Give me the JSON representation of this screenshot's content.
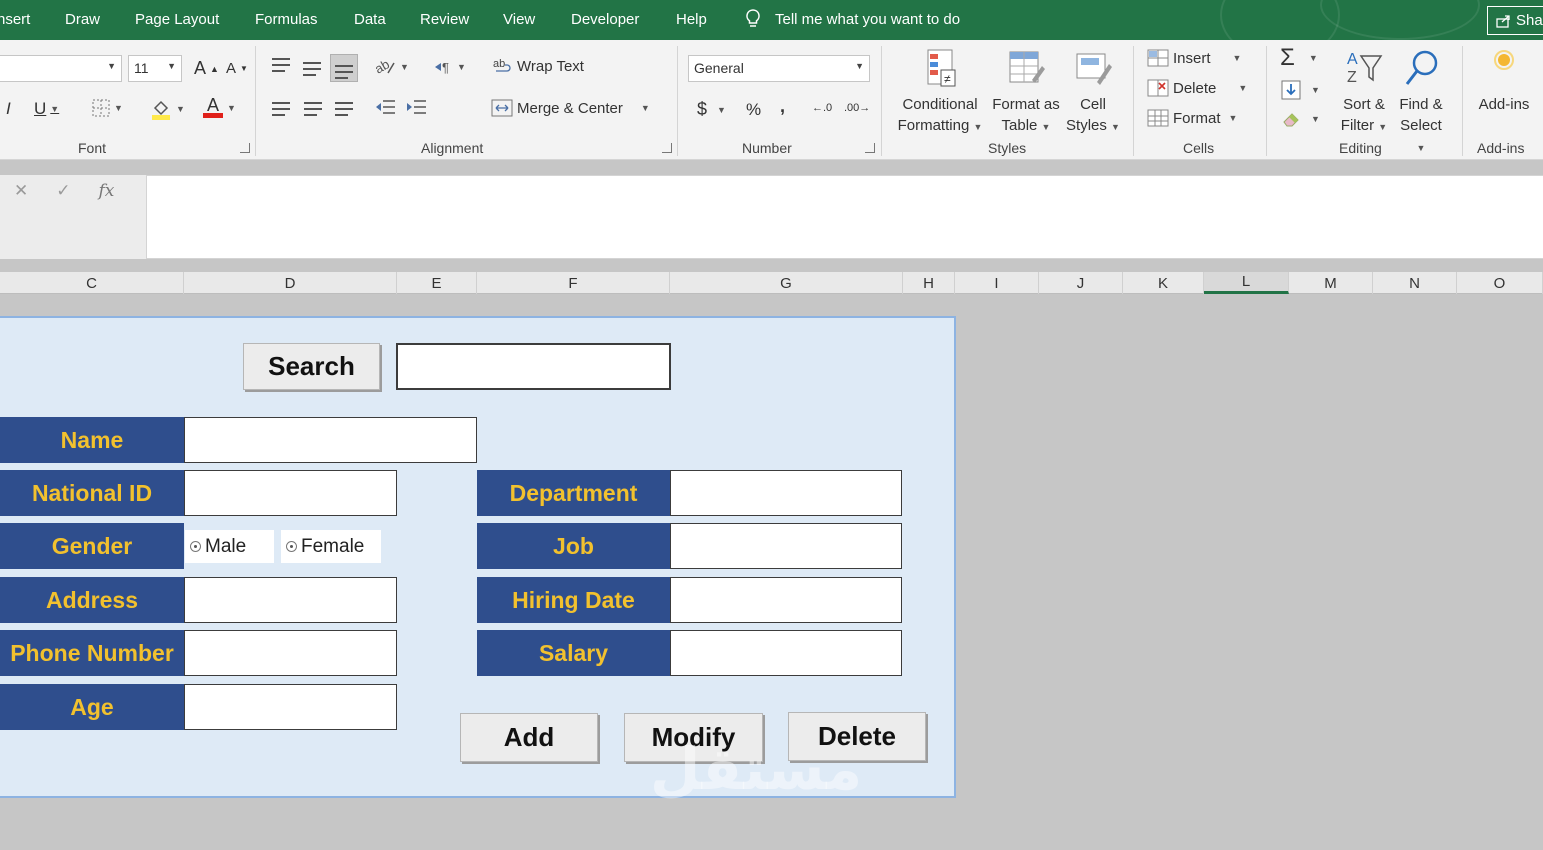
{
  "tabs": [
    "nsert",
    "Draw",
    "Page Layout",
    "Formulas",
    "Data",
    "Review",
    "View",
    "Developer",
    "Help"
  ],
  "tell_me": "Tell me what you want to do",
  "share_label": "Sha",
  "ribbon": {
    "font": {
      "font_name": "",
      "font_size": "11",
      "grow_font": "A",
      "shrink_font": "A",
      "italic": "I",
      "underline": "U",
      "font_color_glyph": "A",
      "group_label": "Font"
    },
    "alignment": {
      "wrap_text": "Wrap Text",
      "merge_center": "Merge & Center",
      "group_label": "Alignment"
    },
    "number": {
      "format": "General",
      "currency": "$",
      "percent": "%",
      "comma": ",",
      "increase_decimal": "←.0",
      "decrease_decimal": ".00→",
      "group_label": "Number"
    },
    "styles": {
      "conditional_formatting": [
        "Conditional",
        "Formatting"
      ],
      "format_as_table": [
        "Format as",
        "Table"
      ],
      "cell_styles": [
        "Cell",
        "Styles"
      ],
      "group_label": "Styles"
    },
    "cells": {
      "insert": "Insert",
      "delete": "Delete",
      "format": "Format",
      "group_label": "Cells"
    },
    "editing": {
      "autosum": "Σ",
      "sort_filter": [
        "Sort &",
        "Filter"
      ],
      "find_select": [
        "Find &",
        "Select"
      ],
      "group_label": "Editing"
    },
    "addins": {
      "label": "Add-ins",
      "group_label": "Add-ins"
    }
  },
  "formula_bar": {
    "cancel": "✕",
    "enter": "✓",
    "fx": "fx",
    "value": ""
  },
  "columns": [
    "C",
    "D",
    "E",
    "F",
    "G",
    "H",
    "I",
    "J",
    "K",
    "L",
    "M",
    "N",
    "O"
  ],
  "selected_column": "L",
  "form": {
    "search_button": "Search",
    "search_value": "",
    "left_labels": [
      "Name",
      "National ID",
      "Gender",
      "Address",
      "Phone Number",
      "Age"
    ],
    "gender_options": [
      "Male",
      "Female"
    ],
    "right_labels": [
      "Department",
      "Job",
      "Hiring Date",
      "Salary"
    ],
    "buttons": [
      "Add",
      "Modify",
      "Delete"
    ]
  },
  "watermark": "مستقل",
  "colors": {
    "title_bar": "#227446",
    "label_bg": "#2f4e8d",
    "label_text": "#f2c12e",
    "form_bg": "#deeaf6",
    "form_border": "#8db3e2",
    "sheet_bg": "#c6c6c6"
  }
}
